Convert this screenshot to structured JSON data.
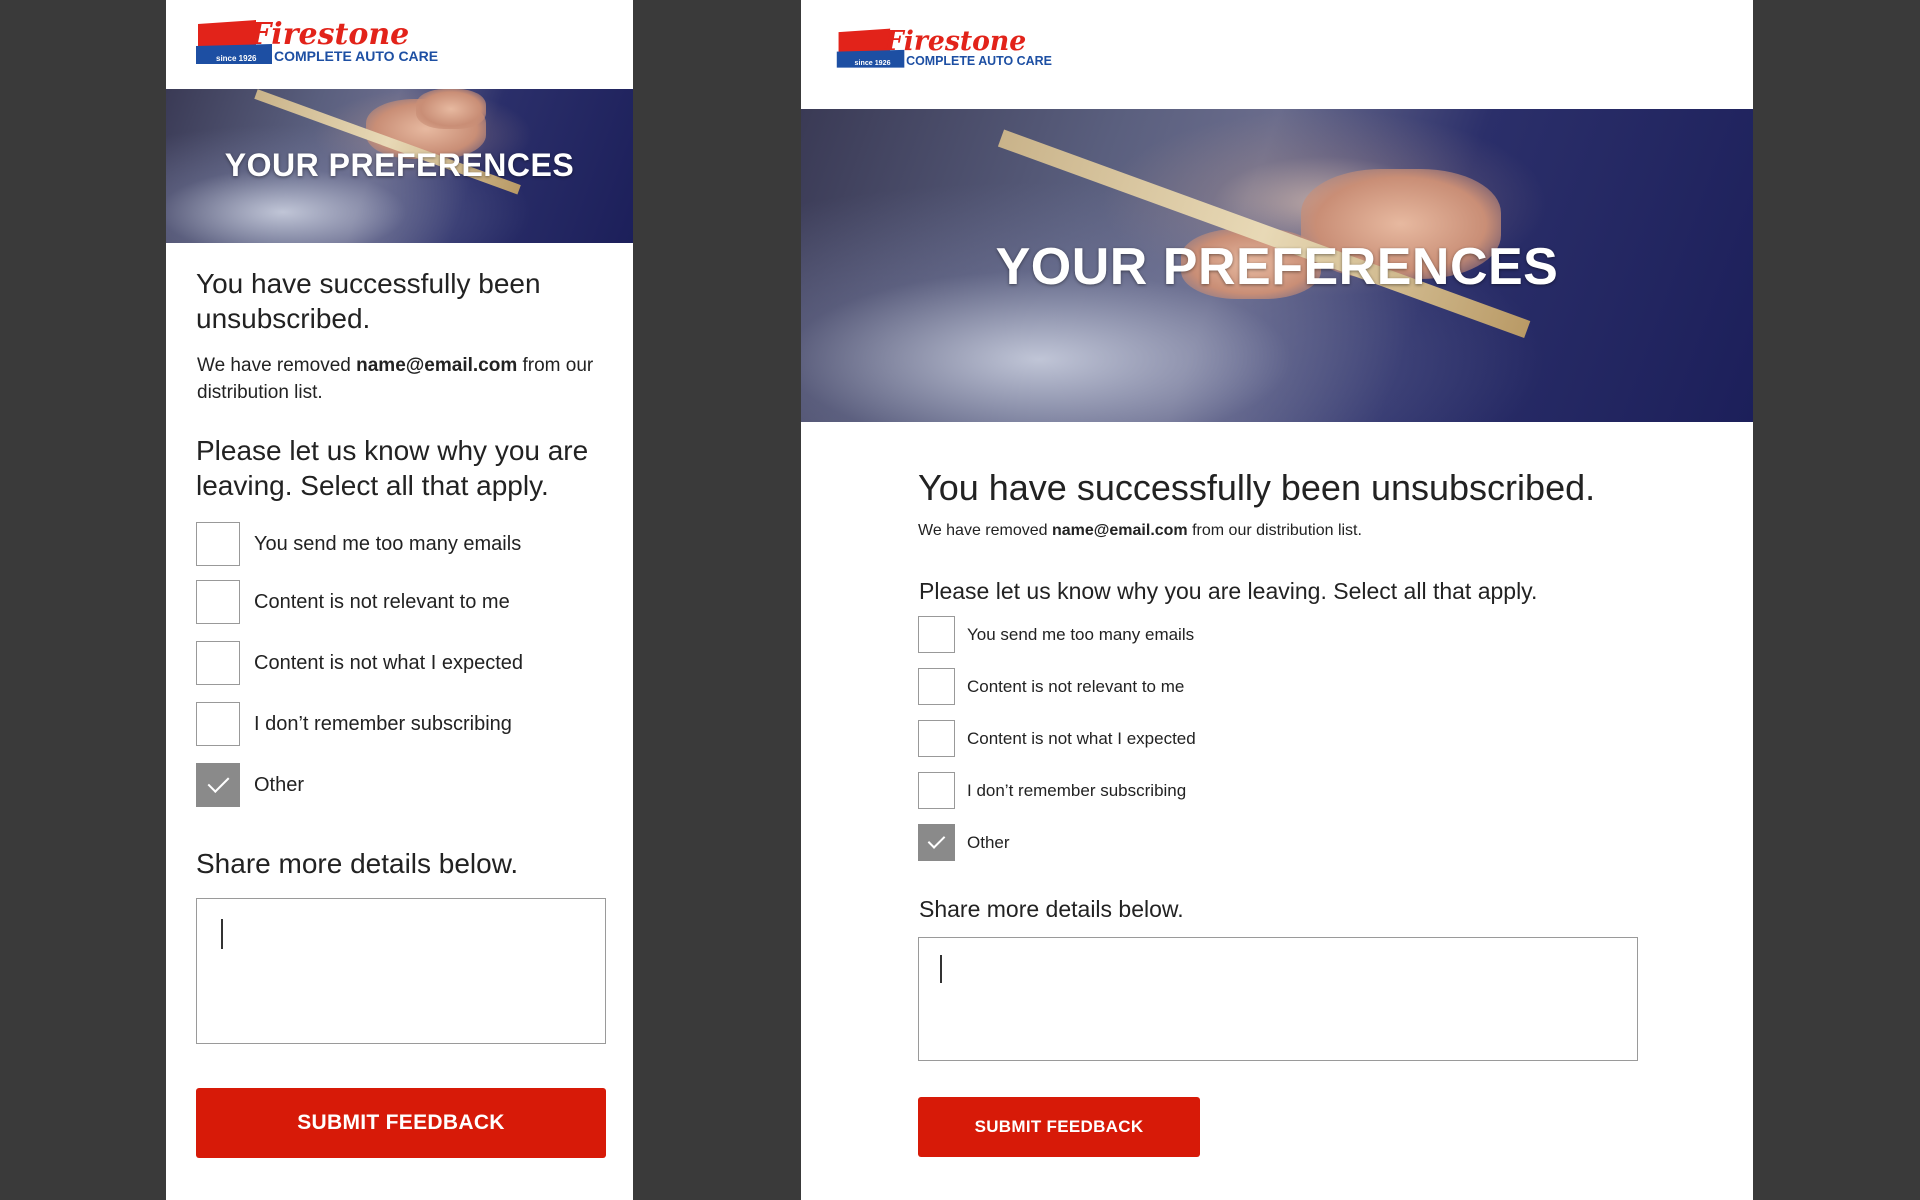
{
  "brand": {
    "name": "Firestone",
    "since": "since 1926",
    "tagline": "COMPLETE AUTO CARE",
    "colors": {
      "red": "#e2231a",
      "blue": "#1d4fa3"
    }
  },
  "hero": {
    "title": "YOUR PREFERENCES"
  },
  "confirmation": {
    "heading": "You have successfully been unsubscribed.",
    "removed_prefix": "We have removed",
    "email": "name@email.com",
    "removed_suffix": "from our distribution list."
  },
  "survey": {
    "question": "Please let us know why you are leaving. Select all that apply.",
    "options": [
      {
        "label": "You send me too many emails",
        "checked": false
      },
      {
        "label": "Content is not relevant to me",
        "checked": false
      },
      {
        "label": "Content is not what I expected",
        "checked": false
      },
      {
        "label": "I don’t remember subscribing",
        "checked": false
      },
      {
        "label": "Other",
        "checked": true
      }
    ],
    "details_label": "Share more details below.",
    "details_value": ""
  },
  "actions": {
    "submit_label": "SUBMIT FEEDBACK",
    "submit_color": "#d71a08"
  }
}
